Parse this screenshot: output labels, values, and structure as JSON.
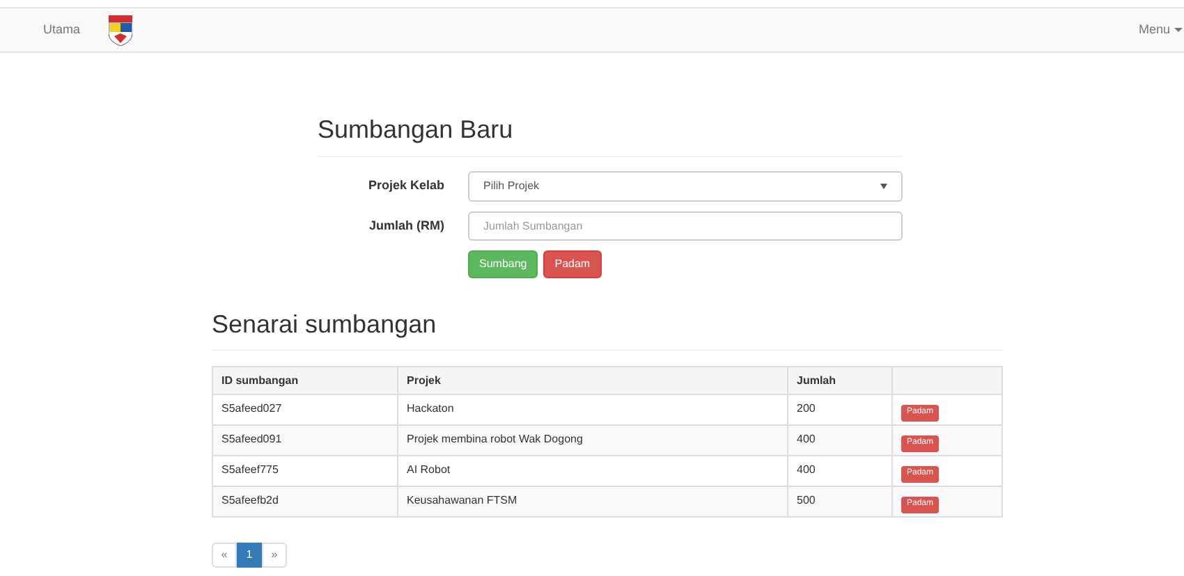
{
  "navbar": {
    "brand": "Utama",
    "menu": "Menu"
  },
  "form": {
    "title": "Sumbangan Baru",
    "fields": [
      {
        "kind": "select",
        "label": "Projek Kelab",
        "value": "Pilih Projek"
      },
      {
        "kind": "input",
        "label": "Jumlah (RM)",
        "placeholder": "Jumlah Sumbangan"
      }
    ],
    "buttons": [
      {
        "kind": "success",
        "label": "Sumbang"
      },
      {
        "kind": "danger",
        "label": "Padam"
      }
    ]
  },
  "list": {
    "title": "Senarai sumbangan",
    "columns": [
      "ID sumbangan",
      "Projek",
      "Jumlah"
    ],
    "rows": [
      {
        "id": "S5afeed027",
        "project": "Hackaton",
        "amount": "200",
        "action": "Padam"
      },
      {
        "id": "S5afeed091",
        "project": "Projek membina robot Wak Dogong",
        "amount": "400",
        "action": "Padam"
      },
      {
        "id": "S5afeef775",
        "project": "AI Robot",
        "amount": "400",
        "action": "Padam"
      },
      {
        "id": "S5afeefb2d",
        "project": "Keusahawanan FTSM",
        "amount": "500",
        "action": "Padam"
      }
    ]
  },
  "pagination": [
    {
      "label": "«",
      "selected": false
    },
    {
      "label": "1",
      "selected": true
    },
    {
      "label": "»",
      "selected": false
    }
  ]
}
